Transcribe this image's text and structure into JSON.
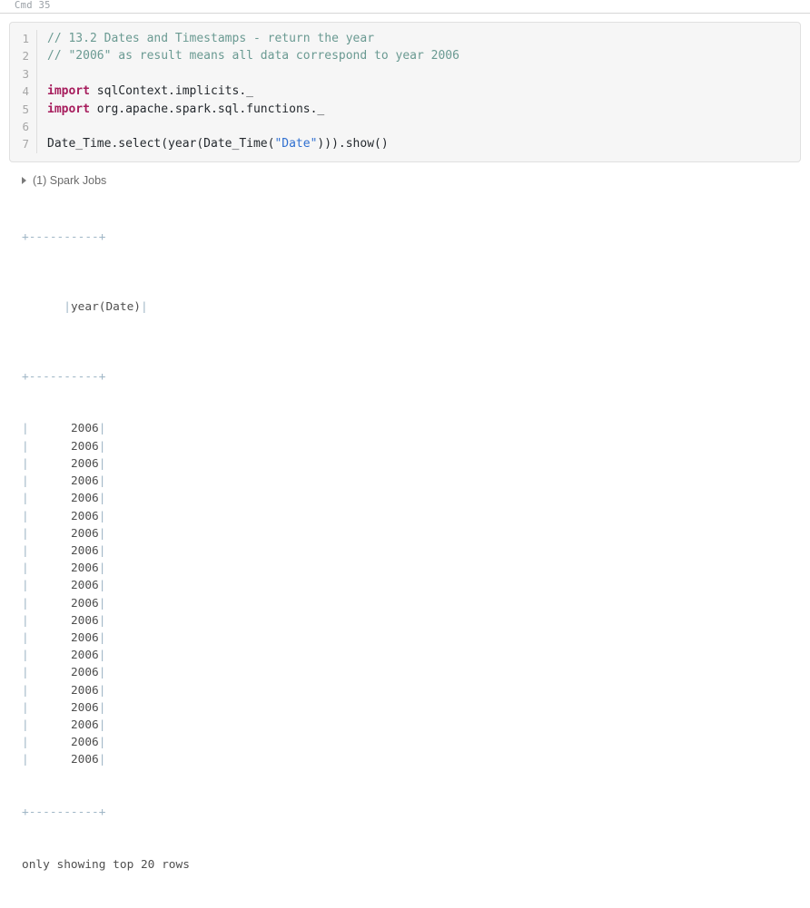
{
  "cell": {
    "label": "Cmd 35",
    "line_numbers": [
      "1",
      "2",
      "3",
      "4",
      "5",
      "6",
      "7"
    ],
    "code_lines": [
      {
        "n": "1",
        "tokens": [
          {
            "t": "comment",
            "s": "// 13.2 Dates and Timestamps - return the year"
          }
        ]
      },
      {
        "n": "2",
        "tokens": [
          {
            "t": "comment",
            "s": "// \"2006\" as result means all data correspond to year 2006"
          }
        ]
      },
      {
        "n": "3",
        "tokens": [
          {
            "t": "plain",
            "s": ""
          }
        ]
      },
      {
        "n": "4",
        "tokens": [
          {
            "t": "keyword",
            "s": "import"
          },
          {
            "t": "plain",
            "s": " sqlContext.implicits._"
          }
        ]
      },
      {
        "n": "5",
        "tokens": [
          {
            "t": "keyword",
            "s": "import"
          },
          {
            "t": "plain",
            "s": " org.apache.spark.sql.functions._"
          }
        ]
      },
      {
        "n": "6",
        "tokens": [
          {
            "t": "plain",
            "s": ""
          }
        ]
      },
      {
        "n": "7",
        "tokens": [
          {
            "t": "plain",
            "s": "Date_Time.select(year(Date_Time("
          },
          {
            "t": "string",
            "s": "\"Date\""
          },
          {
            "t": "plain",
            "s": "))).show()"
          }
        ]
      }
    ]
  },
  "result": {
    "spark_jobs": {
      "icon": "triangle-right-icon",
      "label": "(1) Spark Jobs",
      "count": 1,
      "expanded": false
    },
    "table": {
      "border_line": "+----------+",
      "header_line": "|year(Date)|",
      "column_header": "year(Date)",
      "row_lines": [
        "|      2006|",
        "|      2006|",
        "|      2006|",
        "|      2006|",
        "|      2006|",
        "|      2006|",
        "|      2006|",
        "|      2006|",
        "|      2006|",
        "|      2006|",
        "|      2006|",
        "|      2006|",
        "|      2006|",
        "|      2006|",
        "|      2006|",
        "|      2006|",
        "|      2006|",
        "|      2006|",
        "|      2006|",
        "|      2006|"
      ],
      "values": [
        2006,
        2006,
        2006,
        2006,
        2006,
        2006,
        2006,
        2006,
        2006,
        2006,
        2006,
        2006,
        2006,
        2006,
        2006,
        2006,
        2006,
        2006,
        2006,
        2006
      ],
      "row_count": 20,
      "footer": "only showing top 20 rows"
    }
  },
  "colors": {
    "comment": "#6a9a92",
    "keyword": "#a71d5d",
    "string": "#2f6fd0",
    "code_text": "#24292e",
    "editor_bg": "#f6f6f6",
    "editor_border": "#e0e0e0",
    "gutter_text": "#a6a6a6",
    "output_text": "#4f4f4f",
    "output_rule": "#9fb6c6",
    "muted_label": "#9aa0a6"
  }
}
